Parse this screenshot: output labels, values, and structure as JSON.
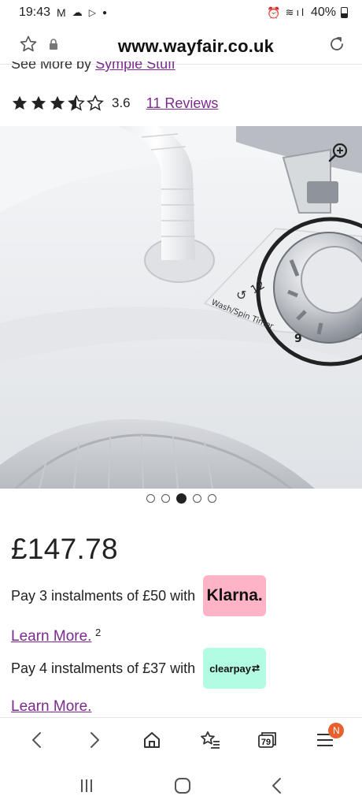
{
  "status_bar": {
    "time": "19:43",
    "battery": "40%"
  },
  "url_bar": {
    "url": "www.wayfair.co.uk"
  },
  "brand_line": {
    "prefix": "See More by",
    "brand": "Symple Stuff"
  },
  "rating": {
    "value": "3.6",
    "stars_filled": 3.5,
    "stars_total": 5,
    "reviews_label": "11 Reviews"
  },
  "gallery": {
    "dial_numbers": [
      "12",
      "9"
    ],
    "dial_caption": "Wash/Spin Timer",
    "image_count": 5,
    "active_index": 2
  },
  "price": "£147.78",
  "klarna": {
    "text": "Pay 3 instalments of £50 with",
    "brand": "Klarna.",
    "learn_more": "Learn More.",
    "footnote": "2"
  },
  "clearpay": {
    "text": "Pay 4 instalments of £37 with",
    "brand": "clearpay",
    "learn_more": "Learn More."
  },
  "browser_nav": {
    "tab_count": "79",
    "menu_badge": "N"
  },
  "colors": {
    "link": "#7b2a8d",
    "klarna_pink": "#ffb3c7",
    "clearpay_mint": "#b2fce4",
    "badge_orange": "#e8612c"
  }
}
